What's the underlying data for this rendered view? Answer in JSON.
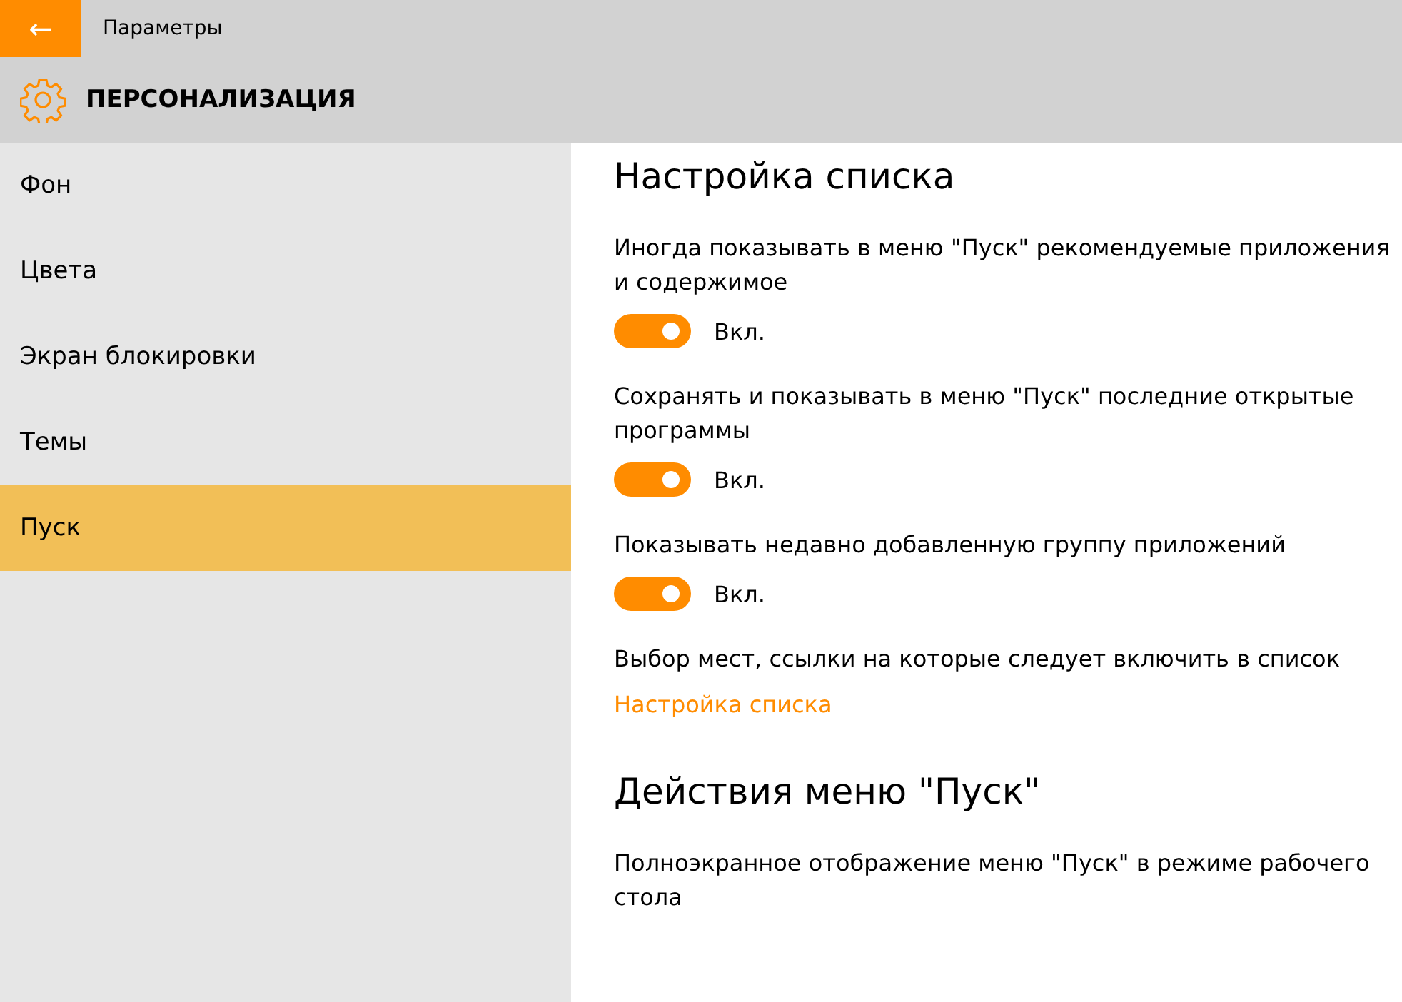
{
  "window": {
    "title": "Параметры",
    "back_button": "←"
  },
  "header": {
    "title": "ПЕРСОНАЛИЗАЦИЯ"
  },
  "sidebar": {
    "items": [
      {
        "label": "Фон",
        "selected": false
      },
      {
        "label": "Цвета",
        "selected": false
      },
      {
        "label": "Экран блокировки",
        "selected": false
      },
      {
        "label": "Темы",
        "selected": false
      },
      {
        "label": "Пуск",
        "selected": true
      }
    ]
  },
  "sections": [
    {
      "title": "Настройка списка",
      "items": [
        {
          "kind": "toggle",
          "label": "Иногда показывать в меню \"Пуск\" рекомендуемые приложения и содержимое",
          "on": true,
          "state_text": "Вкл."
        },
        {
          "kind": "toggle",
          "label": "Сохранять и показывать в меню \"Пуск\" последние открытые программы",
          "on": true,
          "state_text": "Вкл."
        },
        {
          "kind": "toggle",
          "label": "Показывать недавно добавленную группу приложений",
          "on": true,
          "state_text": "Вкл."
        },
        {
          "kind": "link",
          "label": "Выбор мест, ссылки на которые следует включить в список",
          "link": "Настройка списка"
        }
      ]
    },
    {
      "title": "Действия меню \"Пуск\"",
      "items": [
        {
          "kind": "text",
          "label": "Полноэкранное отображение меню \"Пуск\" в режиме рабочего стола"
        }
      ]
    }
  ]
}
